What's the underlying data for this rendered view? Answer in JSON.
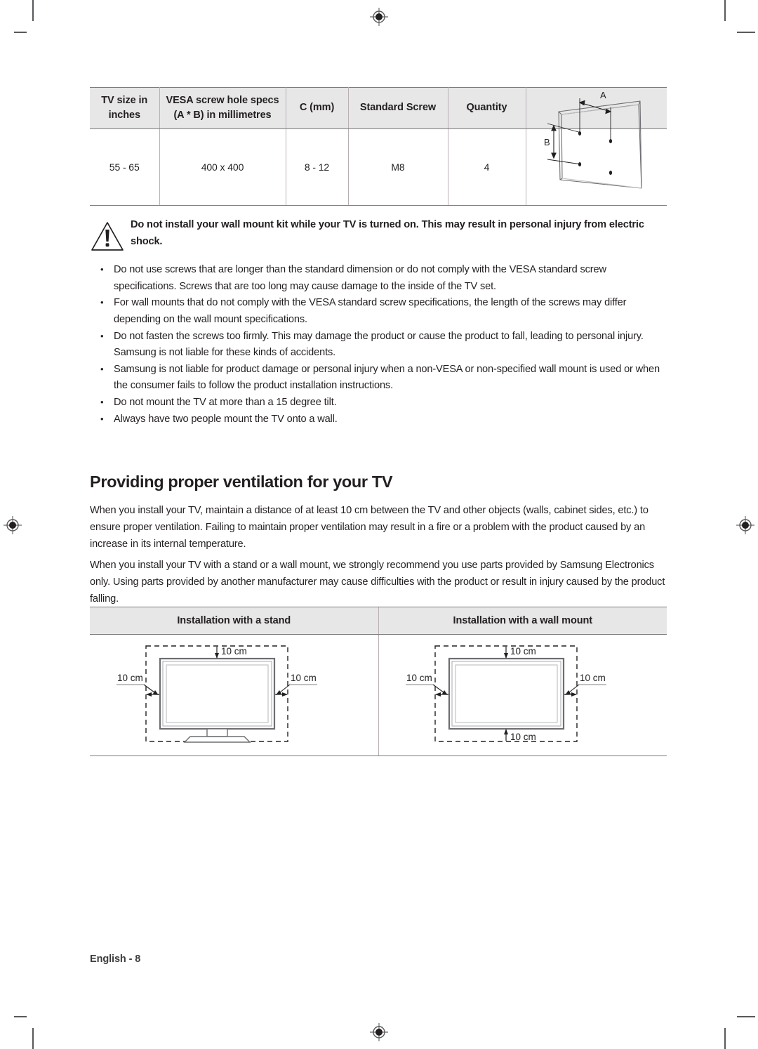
{
  "document": {
    "footer_label": "English - 8"
  },
  "vesa_table": {
    "headers": [
      "TV size in inches",
      "VESA screw hole specs (A * B) in millimetres",
      "C (mm)",
      "Standard Screw",
      "Quantity",
      ""
    ],
    "header_lines": {
      "col1_line1": "TV size in",
      "col1_line2": "inches",
      "col2_line1": "VESA screw hole specs",
      "col2_line2": "(A * B) in millimetres",
      "col3": "C (mm)",
      "col4": "Standard Screw",
      "col5": "Quantity"
    },
    "rows": [
      {
        "tv_size": "55 - 65",
        "vesa_spec": "400 x 400",
        "c_mm": "8 - 12",
        "standard_screw": "M8",
        "quantity": "4"
      }
    ],
    "diagram": {
      "label_a": "A",
      "label_b": "B"
    }
  },
  "warning": {
    "icon": "warning-triangle-icon",
    "text": "Do not install your wall mount kit while your TV is turned on. This may result in personal injury from electric shock."
  },
  "bullets": [
    "Do not use screws that are longer than the standard dimension or do not comply with the VESA standard screw specifications. Screws that are too long may cause damage to the inside of the TV set.",
    "For wall mounts that do not comply with the VESA standard screw specifications, the length of the screws may differ depending on the wall mount specifications.",
    "Do not fasten the screws too firmly. This may damage the product or cause the product to fall, leading to personal injury. Samsung is not liable for these kinds of accidents.",
    "Samsung is not liable for product damage or personal injury when a non-VESA or non-specified wall mount is used or when the consumer fails to follow the product installation instructions.",
    "Do not mount the TV at more than a 15 degree tilt.",
    "Always have two people mount the TV onto a wall."
  ],
  "bullet_marker": "•",
  "section": {
    "title": "Providing proper ventilation for your TV",
    "paragraph_1": "When you install your TV, maintain a distance of at least 10 cm between the TV and other objects (walls, cabinet sides, etc.) to ensure proper ventilation. Failing to maintain proper ventilation may result in a fire or a problem with the product caused by an increase in its internal temperature.",
    "paragraph_2": "When you install your TV with a stand or a wall mount, we strongly recommend you use parts provided by Samsung Electronics only. Using parts provided by another manufacturer may cause difficulties with the product or result in injury caused by the product falling."
  },
  "ventilation_table": {
    "headers": [
      "Installation with a stand",
      "Installation with a wall mount"
    ],
    "stand_diagram": {
      "top_label": "10 cm",
      "left_label": "10 cm",
      "right_label": "10 cm"
    },
    "wallmount_diagram": {
      "top_label": "10 cm",
      "left_label": "10 cm",
      "right_label": "10 cm",
      "bottom_label": "10 cm"
    }
  },
  "colors": {
    "text": "#231f20",
    "header_fill": "#e7e7e8",
    "rule": "#7b7b7b",
    "thin_rule": "#b9b0b6",
    "mark": "#58595b"
  }
}
